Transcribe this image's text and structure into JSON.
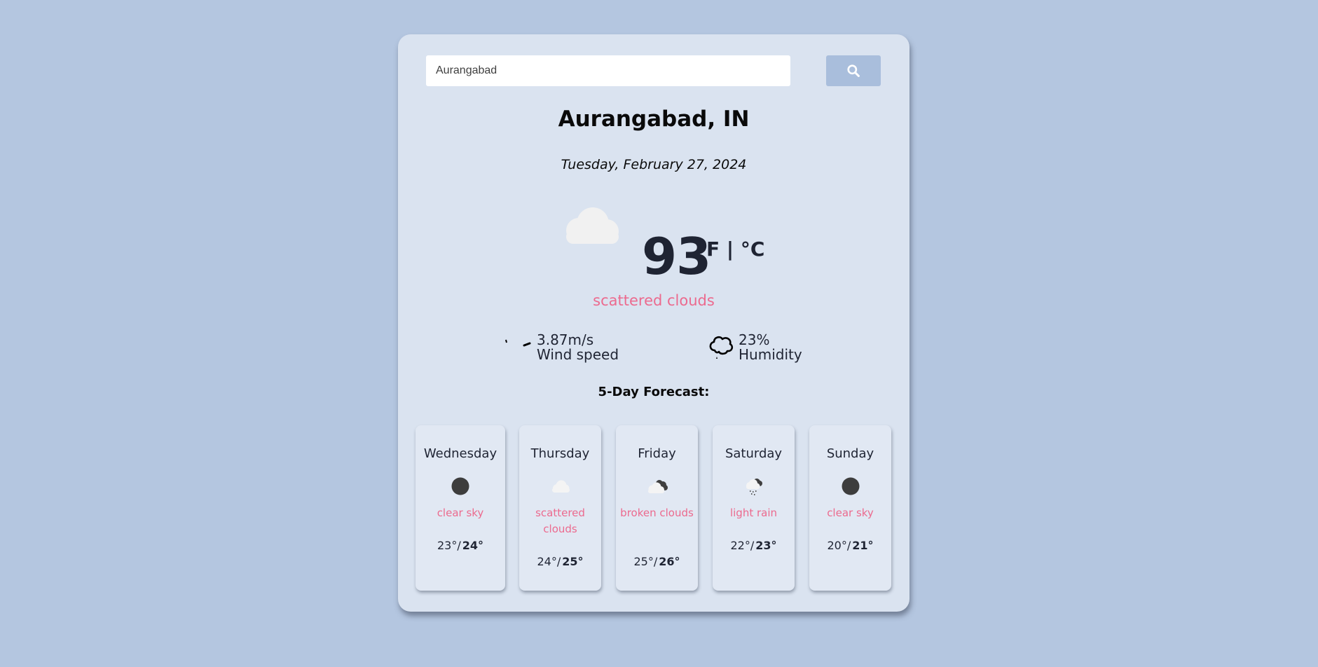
{
  "search": {
    "value": "Aurangabad"
  },
  "current": {
    "city": "Aurangabad, IN",
    "date": "Tuesday, February 27, 2024",
    "icon": "scattered-clouds-icon",
    "temperature": "93",
    "unit_f": "°F",
    "unit_sep": " | ",
    "unit_c": "°C",
    "description": "scattered clouds",
    "wind_value": "3.87m/s",
    "wind_label": "Wind speed",
    "humidity_value": "23%",
    "humidity_label": "Humidity"
  },
  "forecast": {
    "title": "5-Day Forecast:",
    "days": [
      {
        "day": "Wednesday",
        "icon": "clear-sky-icon",
        "description": "clear sky",
        "min": "23°",
        "max": "24°"
      },
      {
        "day": "Thursday",
        "icon": "scattered-clouds-icon",
        "description": "scattered clouds",
        "min": "24°",
        "max": "25°"
      },
      {
        "day": "Friday",
        "icon": "broken-clouds-icon",
        "description": "broken clouds",
        "min": "25°",
        "max": "26°"
      },
      {
        "day": "Saturday",
        "icon": "light-rain-icon",
        "description": "light rain",
        "min": "22°",
        "max": "23°"
      },
      {
        "day": "Sunday",
        "icon": "clear-sky-icon",
        "description": "clear sky",
        "min": "20°",
        "max": "21°"
      }
    ]
  },
  "colors": {
    "background": "#b4c6e0",
    "card": "#dae3f0",
    "accent": "#ec6a8e",
    "button": "#a9bedc",
    "text": "#1f2433"
  }
}
